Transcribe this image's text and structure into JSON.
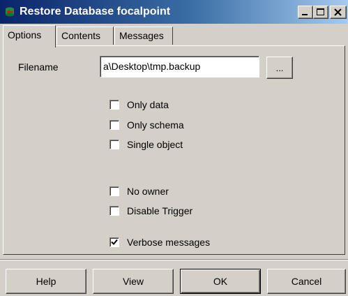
{
  "window": {
    "title": "Restore Database focalpoint",
    "controls": {
      "minimize": "minimize-icon",
      "maximize": "maximize-icon",
      "close": "close-icon"
    }
  },
  "tabs": [
    {
      "label": "Options",
      "active": true
    },
    {
      "label": "Contents",
      "active": false
    },
    {
      "label": "Messages",
      "active": false
    }
  ],
  "options": {
    "filename_label": "Filename",
    "filename_value": "a\\Desktop\\tmp.backup",
    "browse_label": "...",
    "checkboxes": [
      {
        "label": "Only data",
        "checked": false
      },
      {
        "label": "Only schema",
        "checked": false
      },
      {
        "label": "Single object",
        "checked": false
      },
      {
        "label": "No owner",
        "checked": false
      },
      {
        "label": "Disable Trigger",
        "checked": false
      },
      {
        "label": "Verbose messages",
        "checked": true
      }
    ]
  },
  "buttons": {
    "help": "Help",
    "view": "View",
    "ok": "OK",
    "cancel": "Cancel"
  },
  "colors": {
    "title_gradient_start": "#0a246a",
    "title_gradient_end": "#a6caf0",
    "face": "#d4d0c8"
  }
}
